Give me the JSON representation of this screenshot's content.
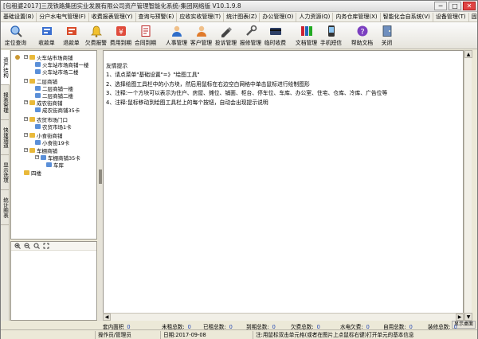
{
  "window": {
    "title": "[包租婆2017]三茂铁路集团实业发展有限公司资产管理智能化系统-集团网络版 V10.1.9.8",
    "btn_min": "─",
    "btn_max": "□",
    "btn_close": "✕"
  },
  "menubar": {
    "items": [
      "基础设置(B)",
      "分户水电气管理(F)",
      "收费报表管理(Y)",
      "查询与预警(E)",
      "应收实收管理(T)",
      "统计图表(Z)",
      "办公管理(O)",
      "人力资源(Q)",
      "内务仓库管理(X)",
      "智能化合自系统(V)",
      "设备管理(T)",
      "固定资产"
    ]
  },
  "toolbar": {
    "buttons": [
      {
        "label": "定位查询",
        "icon": "locate-icon"
      },
      {
        "label": "收款单",
        "icon": "receipt-icon"
      },
      {
        "label": "退款单",
        "icon": "refund-icon"
      },
      {
        "label": "欠费报警",
        "icon": "alarm-icon"
      },
      {
        "label": "费用到期",
        "icon": "fee-due-icon"
      },
      {
        "label": "合同到期",
        "icon": "contract-due-icon"
      },
      {
        "label": "人事管理",
        "icon": "personnel-icon"
      },
      {
        "label": "客户管理",
        "icon": "customer-icon"
      },
      {
        "label": "投诉管理",
        "icon": "complaint-icon"
      },
      {
        "label": "报修管理",
        "icon": "repair-icon"
      },
      {
        "label": "临时收费",
        "icon": "temp-fee-icon"
      },
      {
        "label": "文档管理",
        "icon": "document-icon"
      },
      {
        "label": "手机短信",
        "icon": "sms-icon"
      },
      {
        "label": "帮助文档",
        "icon": "help-icon"
      },
      {
        "label": "关闭",
        "icon": "close-app-icon"
      }
    ]
  },
  "left_tabs": [
    "资产结构",
    "报表管理",
    "快速通道",
    "显示选项",
    "统计图表"
  ],
  "tree": {
    "nodes": [
      {
        "label": "火车站市场商铺",
        "level": 1,
        "exp": "−"
      },
      {
        "label": "火车站市场商铺一楼",
        "level": 2,
        "exp": ""
      },
      {
        "label": "火车站市场二楼",
        "level": 2,
        "exp": ""
      },
      {
        "label": "二层商铺",
        "level": 1,
        "exp": "−"
      },
      {
        "label": "二层商铺一楼",
        "level": 2,
        "exp": ""
      },
      {
        "label": "二层商铺二楼",
        "level": 2,
        "exp": ""
      },
      {
        "label": "成农街商铺",
        "level": 1,
        "exp": "−"
      },
      {
        "label": "成农街商铺35卡",
        "level": 2,
        "exp": ""
      },
      {
        "label": "农贸市场门口",
        "level": 1,
        "exp": "−"
      },
      {
        "label": "农贸市场1卡",
        "level": 2,
        "exp": ""
      },
      {
        "label": "小食街商铺",
        "level": 1,
        "exp": "−"
      },
      {
        "label": "小食街19卡",
        "level": 2,
        "exp": ""
      },
      {
        "label": "车棚商铺",
        "level": 1,
        "exp": "−"
      },
      {
        "label": "车棚商铺35卡",
        "level": 2,
        "exp": "−"
      },
      {
        "label": "车库",
        "level": 3,
        "exp": ""
      },
      {
        "label": "四楼",
        "level": 1,
        "exp": ""
      }
    ]
  },
  "hint": {
    "title": "友情提示",
    "lines": [
      "1、请点菜单\"基础设置\"=》\"绘图工具\"",
      "2、选择绘图工具栏中的小方块，然后用鼠标在右边空白网格中单击鼠标进行绘制图形",
      "3、注释:一个方块可以表示为住户、房屋、摊位、铺面、柜台、停车位、车库、办公室、住宅、仓库、冷库、广告位等",
      "4、注释:鼠标移动到绘图工具栏上的每个按钮，自动会出现提示说明"
    ]
  },
  "stats": {
    "items": [
      {
        "label": "套内面积",
        "value": "0"
      },
      {
        "label": "未租总数:",
        "value": "0"
      },
      {
        "label": "已租总数:",
        "value": "0"
      },
      {
        "label": "到期总数:",
        "value": "0"
      },
      {
        "label": "欠费总数:",
        "value": "0"
      },
      {
        "label": "水电欠费:",
        "value": "0"
      },
      {
        "label": "自用总数:",
        "value": "0"
      },
      {
        "label": "装修总数:",
        "value": "0"
      }
    ]
  },
  "status": {
    "operator": "操作员/管理员",
    "date": "日期:2017-09-08",
    "tip": "注:用鼠标双击单元格(或者在图片上点鼠标右键)打开单元的基本信息"
  },
  "show_desktop": "显示桌面",
  "colors": {
    "folder": "#e9b93a",
    "unit": "#5a8fd8",
    "value_blue": "#1a3fb0"
  }
}
